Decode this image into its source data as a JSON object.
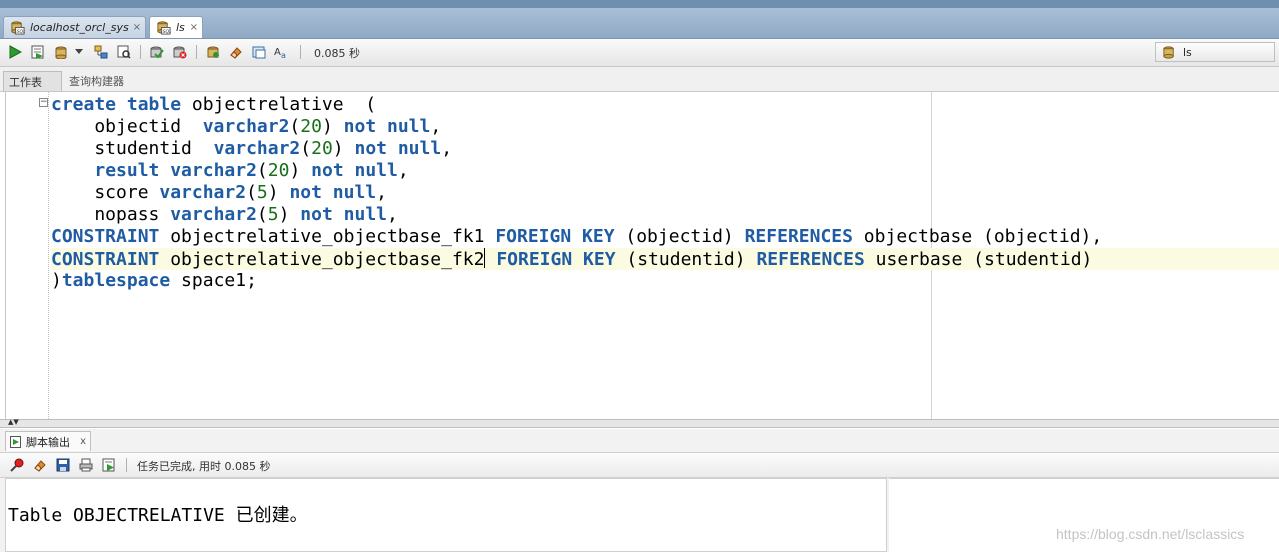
{
  "tabs": [
    {
      "label": "localhost_orcl_sys",
      "close": "×",
      "active": false
    },
    {
      "label": "ls",
      "close": "×",
      "active": true
    }
  ],
  "toolbar": {
    "timing": "0.085 秒",
    "connection": "ls"
  },
  "subtabs": [
    {
      "label": "工作表",
      "selected": true
    },
    {
      "label": "查询构建器",
      "selected": false
    }
  ],
  "editor": {
    "lines": [
      [
        {
          "t": "create table",
          "k": "kw"
        },
        {
          "t": " objectrelative  ("
        }
      ],
      [
        {
          "t": "    objectid  "
        },
        {
          "t": "varchar2",
          "k": "kw"
        },
        {
          "t": "("
        },
        {
          "t": "20",
          "k": "num"
        },
        {
          "t": ") "
        },
        {
          "t": "not null",
          "k": "kw"
        },
        {
          "t": ","
        }
      ],
      [
        {
          "t": "    studentid  "
        },
        {
          "t": "varchar2",
          "k": "kw"
        },
        {
          "t": "("
        },
        {
          "t": "20",
          "k": "num"
        },
        {
          "t": ") "
        },
        {
          "t": "not null",
          "k": "kw"
        },
        {
          "t": ","
        }
      ],
      [
        {
          "t": "    "
        },
        {
          "t": "result varchar2",
          "k": "kw"
        },
        {
          "t": "("
        },
        {
          "t": "20",
          "k": "num"
        },
        {
          "t": ") "
        },
        {
          "t": "not null",
          "k": "kw"
        },
        {
          "t": ","
        }
      ],
      [
        {
          "t": "    score "
        },
        {
          "t": "varchar2",
          "k": "kw"
        },
        {
          "t": "("
        },
        {
          "t": "5",
          "k": "num"
        },
        {
          "t": ") "
        },
        {
          "t": "not null",
          "k": "kw"
        },
        {
          "t": ","
        }
      ],
      [
        {
          "t": "    nopass "
        },
        {
          "t": "varchar2",
          "k": "kw"
        },
        {
          "t": "("
        },
        {
          "t": "5",
          "k": "num"
        },
        {
          "t": ") "
        },
        {
          "t": "not null",
          "k": "kw"
        },
        {
          "t": ","
        }
      ],
      [
        {
          "t": "CONSTRAINT",
          "k": "kw"
        },
        {
          "t": " objectrelative_objectbase_fk1 "
        },
        {
          "t": "FOREIGN KEY",
          "k": "kw"
        },
        {
          "t": " (objectid) "
        },
        {
          "t": "REFERENCES",
          "k": "kw"
        },
        {
          "t": " objectbase (objectid),"
        }
      ],
      [
        {
          "t": "CONSTRAINT",
          "k": "kw"
        },
        {
          "t": " objectrelative_objectbase_fk2"
        },
        {
          "t": "",
          "k": "caret"
        },
        {
          "t": " "
        },
        {
          "t": "FOREIGN KEY",
          "k": "kw"
        },
        {
          "t": " (studentid) "
        },
        {
          "t": "REFERENCES",
          "k": "kw"
        },
        {
          "t": " userbase (studentid)"
        }
      ],
      [
        {
          "t": ")"
        },
        {
          "t": "tablespace",
          "k": "kw"
        },
        {
          "t": " space1;"
        }
      ]
    ],
    "current_line": 8
  },
  "output": {
    "tab_label": "脚本输出",
    "tab_close": "x",
    "status": "任务已完成, 用时 0.085 秒",
    "result": "Table OBJECTRELATIVE 已创建。"
  },
  "watermark": "https://blog.csdn.net/lsclassics",
  "colors": {
    "keyword": "#1f5ca3",
    "number": "#187018",
    "tabbar": "#8fa9c5"
  }
}
